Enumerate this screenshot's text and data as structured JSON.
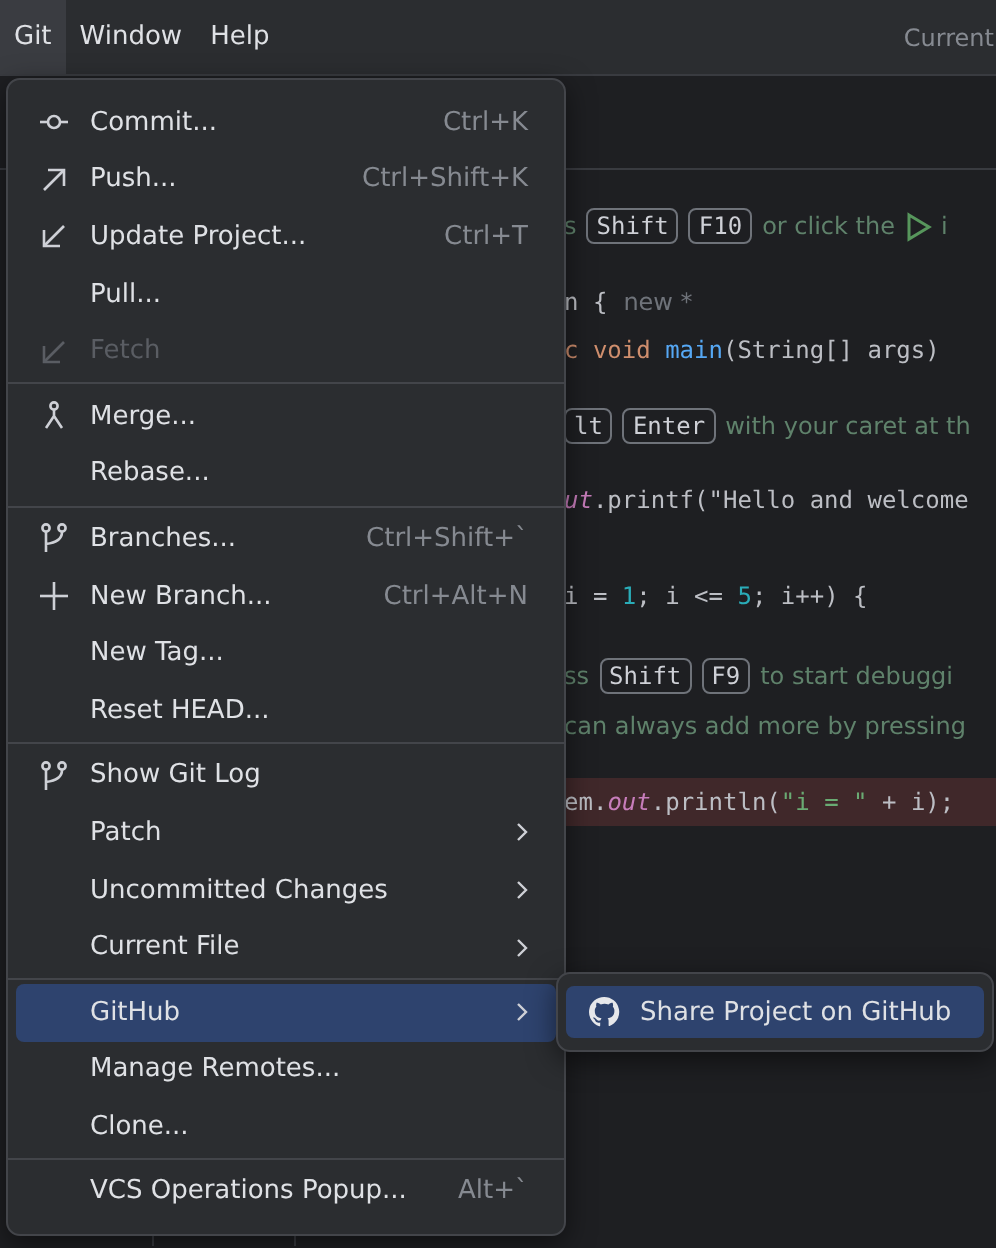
{
  "menu_bar": {
    "items": [
      {
        "label": "Git",
        "selected": true
      },
      {
        "label": "Window",
        "selected": false
      },
      {
        "label": "Help",
        "selected": false
      }
    ],
    "right_text": "Current"
  },
  "editor": {
    "lines": [
      {
        "breakpoint": false,
        "segments": [
          {
            "kind": "comment",
            "text": "s"
          },
          {
            "kind": "key",
            "text": "Shift"
          },
          {
            "kind": "key",
            "text": "F10"
          },
          {
            "kind": "comment",
            "text": "or click the"
          },
          {
            "kind": "play"
          },
          {
            "kind": "comment",
            "text": "i"
          }
        ]
      },
      {
        "breakpoint": false,
        "segments": [
          {
            "kind": "plain",
            "text": "n {"
          },
          {
            "kind": "inlay",
            "text": "new *"
          }
        ]
      },
      {
        "breakpoint": false,
        "segments": [
          {
            "kind": "keyword",
            "text": "c void "
          },
          {
            "kind": "method",
            "text": "main"
          },
          {
            "kind": "plain",
            "text": "(String[] args)"
          }
        ]
      },
      {
        "breakpoint": false,
        "segments": [
          {
            "kind": "key",
            "text": "lt"
          },
          {
            "kind": "key",
            "text": "Enter"
          },
          {
            "kind": "comment",
            "text": "with your caret at th"
          }
        ]
      },
      {
        "breakpoint": false,
        "segments": [
          {
            "kind": "static",
            "text": "ut"
          },
          {
            "kind": "plain",
            "text": ".printf(\"Hello and welcome"
          }
        ]
      },
      {
        "breakpoint": false,
        "segments": [
          {
            "kind": "plain",
            "text": "i = "
          },
          {
            "kind": "number",
            "text": "1"
          },
          {
            "kind": "plain",
            "text": "; i <= "
          },
          {
            "kind": "number",
            "text": "5"
          },
          {
            "kind": "plain",
            "text": "; i++) {"
          }
        ]
      },
      {
        "breakpoint": false,
        "segments": [
          {
            "kind": "comment",
            "text": "ss"
          },
          {
            "kind": "key",
            "text": "Shift"
          },
          {
            "kind": "key",
            "text": "F9"
          },
          {
            "kind": "comment",
            "text": "to start debuggi"
          }
        ]
      },
      {
        "breakpoint": false,
        "segments": [
          {
            "kind": "comment",
            "text": "can always add more by pressing"
          }
        ]
      },
      {
        "breakpoint": true,
        "segments": [
          {
            "kind": "plain",
            "text": "em."
          },
          {
            "kind": "static",
            "text": "out"
          },
          {
            "kind": "plain",
            "text": ".println("
          },
          {
            "kind": "string",
            "text": "\"i = \""
          },
          {
            "kind": "plain",
            "text": " + i);"
          }
        ]
      }
    ]
  },
  "git_menu": {
    "items": [
      {
        "kind": "item",
        "label": "Commit...",
        "shortcut": "Ctrl+K",
        "submenu": false,
        "disabled": false,
        "selected": false
      },
      {
        "kind": "item",
        "label": "Push...",
        "shortcut": "Ctrl+Shift+K",
        "submenu": false,
        "disabled": false,
        "selected": false
      },
      {
        "kind": "item",
        "label": "Update Project...",
        "shortcut": "Ctrl+T",
        "submenu": false,
        "disabled": false,
        "selected": false
      },
      {
        "kind": "item",
        "label": "Pull...",
        "submenu": false,
        "disabled": false,
        "selected": false
      },
      {
        "kind": "item",
        "label": "Fetch",
        "submenu": false,
        "disabled": true,
        "selected": false
      },
      {
        "kind": "separator"
      },
      {
        "kind": "item",
        "label": "Merge...",
        "submenu": false,
        "disabled": false,
        "selected": false
      },
      {
        "kind": "item",
        "label": "Rebase...",
        "submenu": false,
        "disabled": false,
        "selected": false
      },
      {
        "kind": "separator"
      },
      {
        "kind": "item",
        "label": "Branches...",
        "shortcut": "Ctrl+Shift+`",
        "submenu": false,
        "disabled": false,
        "selected": false
      },
      {
        "kind": "item",
        "label": "New Branch...",
        "shortcut": "Ctrl+Alt+N",
        "submenu": false,
        "disabled": false,
        "selected": false
      },
      {
        "kind": "item",
        "label": "New Tag...",
        "submenu": false,
        "disabled": false,
        "selected": false
      },
      {
        "kind": "item",
        "label": "Reset HEAD...",
        "submenu": false,
        "disabled": false,
        "selected": false
      },
      {
        "kind": "separator"
      },
      {
        "kind": "item",
        "label": "Show Git Log",
        "submenu": false,
        "disabled": false,
        "selected": false
      },
      {
        "kind": "item",
        "label": "Patch",
        "submenu": true,
        "disabled": false,
        "selected": false
      },
      {
        "kind": "item",
        "label": "Uncommitted Changes",
        "submenu": true,
        "disabled": false,
        "selected": false
      },
      {
        "kind": "item",
        "label": "Current File",
        "submenu": true,
        "disabled": false,
        "selected": false
      },
      {
        "kind": "separator"
      },
      {
        "kind": "item",
        "label": "GitHub",
        "submenu": true,
        "disabled": false,
        "selected": true
      },
      {
        "kind": "item",
        "label": "Manage Remotes...",
        "submenu": false,
        "disabled": false,
        "selected": false
      },
      {
        "kind": "item",
        "label": "Clone...",
        "submenu": false,
        "disabled": false,
        "selected": false
      },
      {
        "kind": "separator"
      },
      {
        "kind": "item",
        "label": "VCS Operations Popup...",
        "shortcut": "Alt+`",
        "submenu": false,
        "disabled": false,
        "selected": false
      }
    ]
  },
  "github_submenu": {
    "items": [
      {
        "kind": "item",
        "label": "Share Project on GitHub",
        "submenu": false,
        "disabled": false,
        "selected": true
      }
    ]
  }
}
